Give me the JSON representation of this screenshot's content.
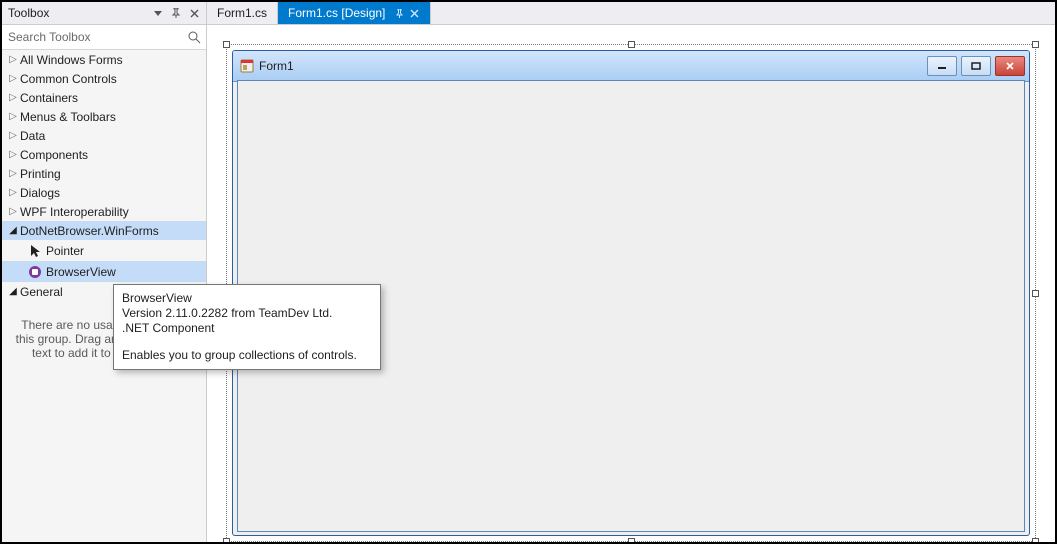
{
  "toolbox": {
    "title": "Toolbox",
    "search_placeholder": "Search Toolbox",
    "categories": [
      {
        "label": "All Windows Forms",
        "expanded": false
      },
      {
        "label": "Common Controls",
        "expanded": false
      },
      {
        "label": "Containers",
        "expanded": false
      },
      {
        "label": "Menus & Toolbars",
        "expanded": false
      },
      {
        "label": "Data",
        "expanded": false
      },
      {
        "label": "Components",
        "expanded": false
      },
      {
        "label": "Printing",
        "expanded": false
      },
      {
        "label": "Dialogs",
        "expanded": false
      },
      {
        "label": "WPF Interoperability",
        "expanded": false
      },
      {
        "label": "DotNetBrowser.WinForms",
        "expanded": true,
        "selected": true,
        "items": [
          {
            "label": "Pointer",
            "icon": "pointer"
          },
          {
            "label": "BrowserView",
            "icon": "component",
            "selected": true
          }
        ]
      },
      {
        "label": "General",
        "expanded": true,
        "empty_msg": "There are no usable controls in this group. Drag an item onto this text to add it to the toolbox."
      }
    ]
  },
  "tabs": [
    {
      "label": "Form1.cs",
      "active": false
    },
    {
      "label": "Form1.cs [Design]",
      "active": true
    }
  ],
  "form": {
    "title": "Form1"
  },
  "tooltip": {
    "title": "BrowserView",
    "line2": "Version 2.11.0.2282 from TeamDev Ltd.",
    "line3": ".NET Component",
    "desc": "Enables you to group collections of controls."
  }
}
